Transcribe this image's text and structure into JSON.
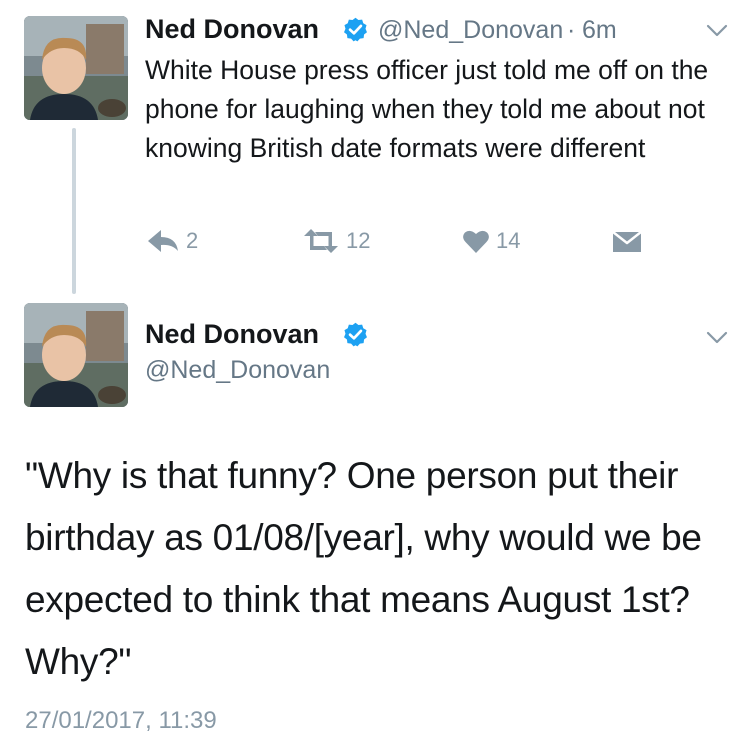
{
  "tweet1": {
    "author_name": "Ned Donovan",
    "handle": "@Ned_Donovan",
    "separator": "·",
    "time_ago": "6m",
    "text": "White House press officer just told me off on the phone for laughing when they told me about not knowing British date formats were different",
    "actions": {
      "reply_count": "2",
      "retweet_count": "12",
      "like_count": "14"
    }
  },
  "tweet2": {
    "author_name": "Ned Donovan",
    "handle": "@Ned_Donovan",
    "text": "\"Why is that funny? One person put their birthday as 01/08/[year], why would we be expected to think that means August 1st? Why?\"",
    "timestamp": "27/01/2017, 11:39"
  },
  "colors": {
    "verified_blue": "#1da1f2",
    "secondary_text": "#657786",
    "icon_gray": "#8899a6",
    "thread_line": "#ccd6dd"
  },
  "icons": [
    "verified-badge-icon",
    "chevron-down-icon",
    "reply-icon",
    "retweet-icon",
    "like-icon",
    "direct-message-icon"
  ]
}
